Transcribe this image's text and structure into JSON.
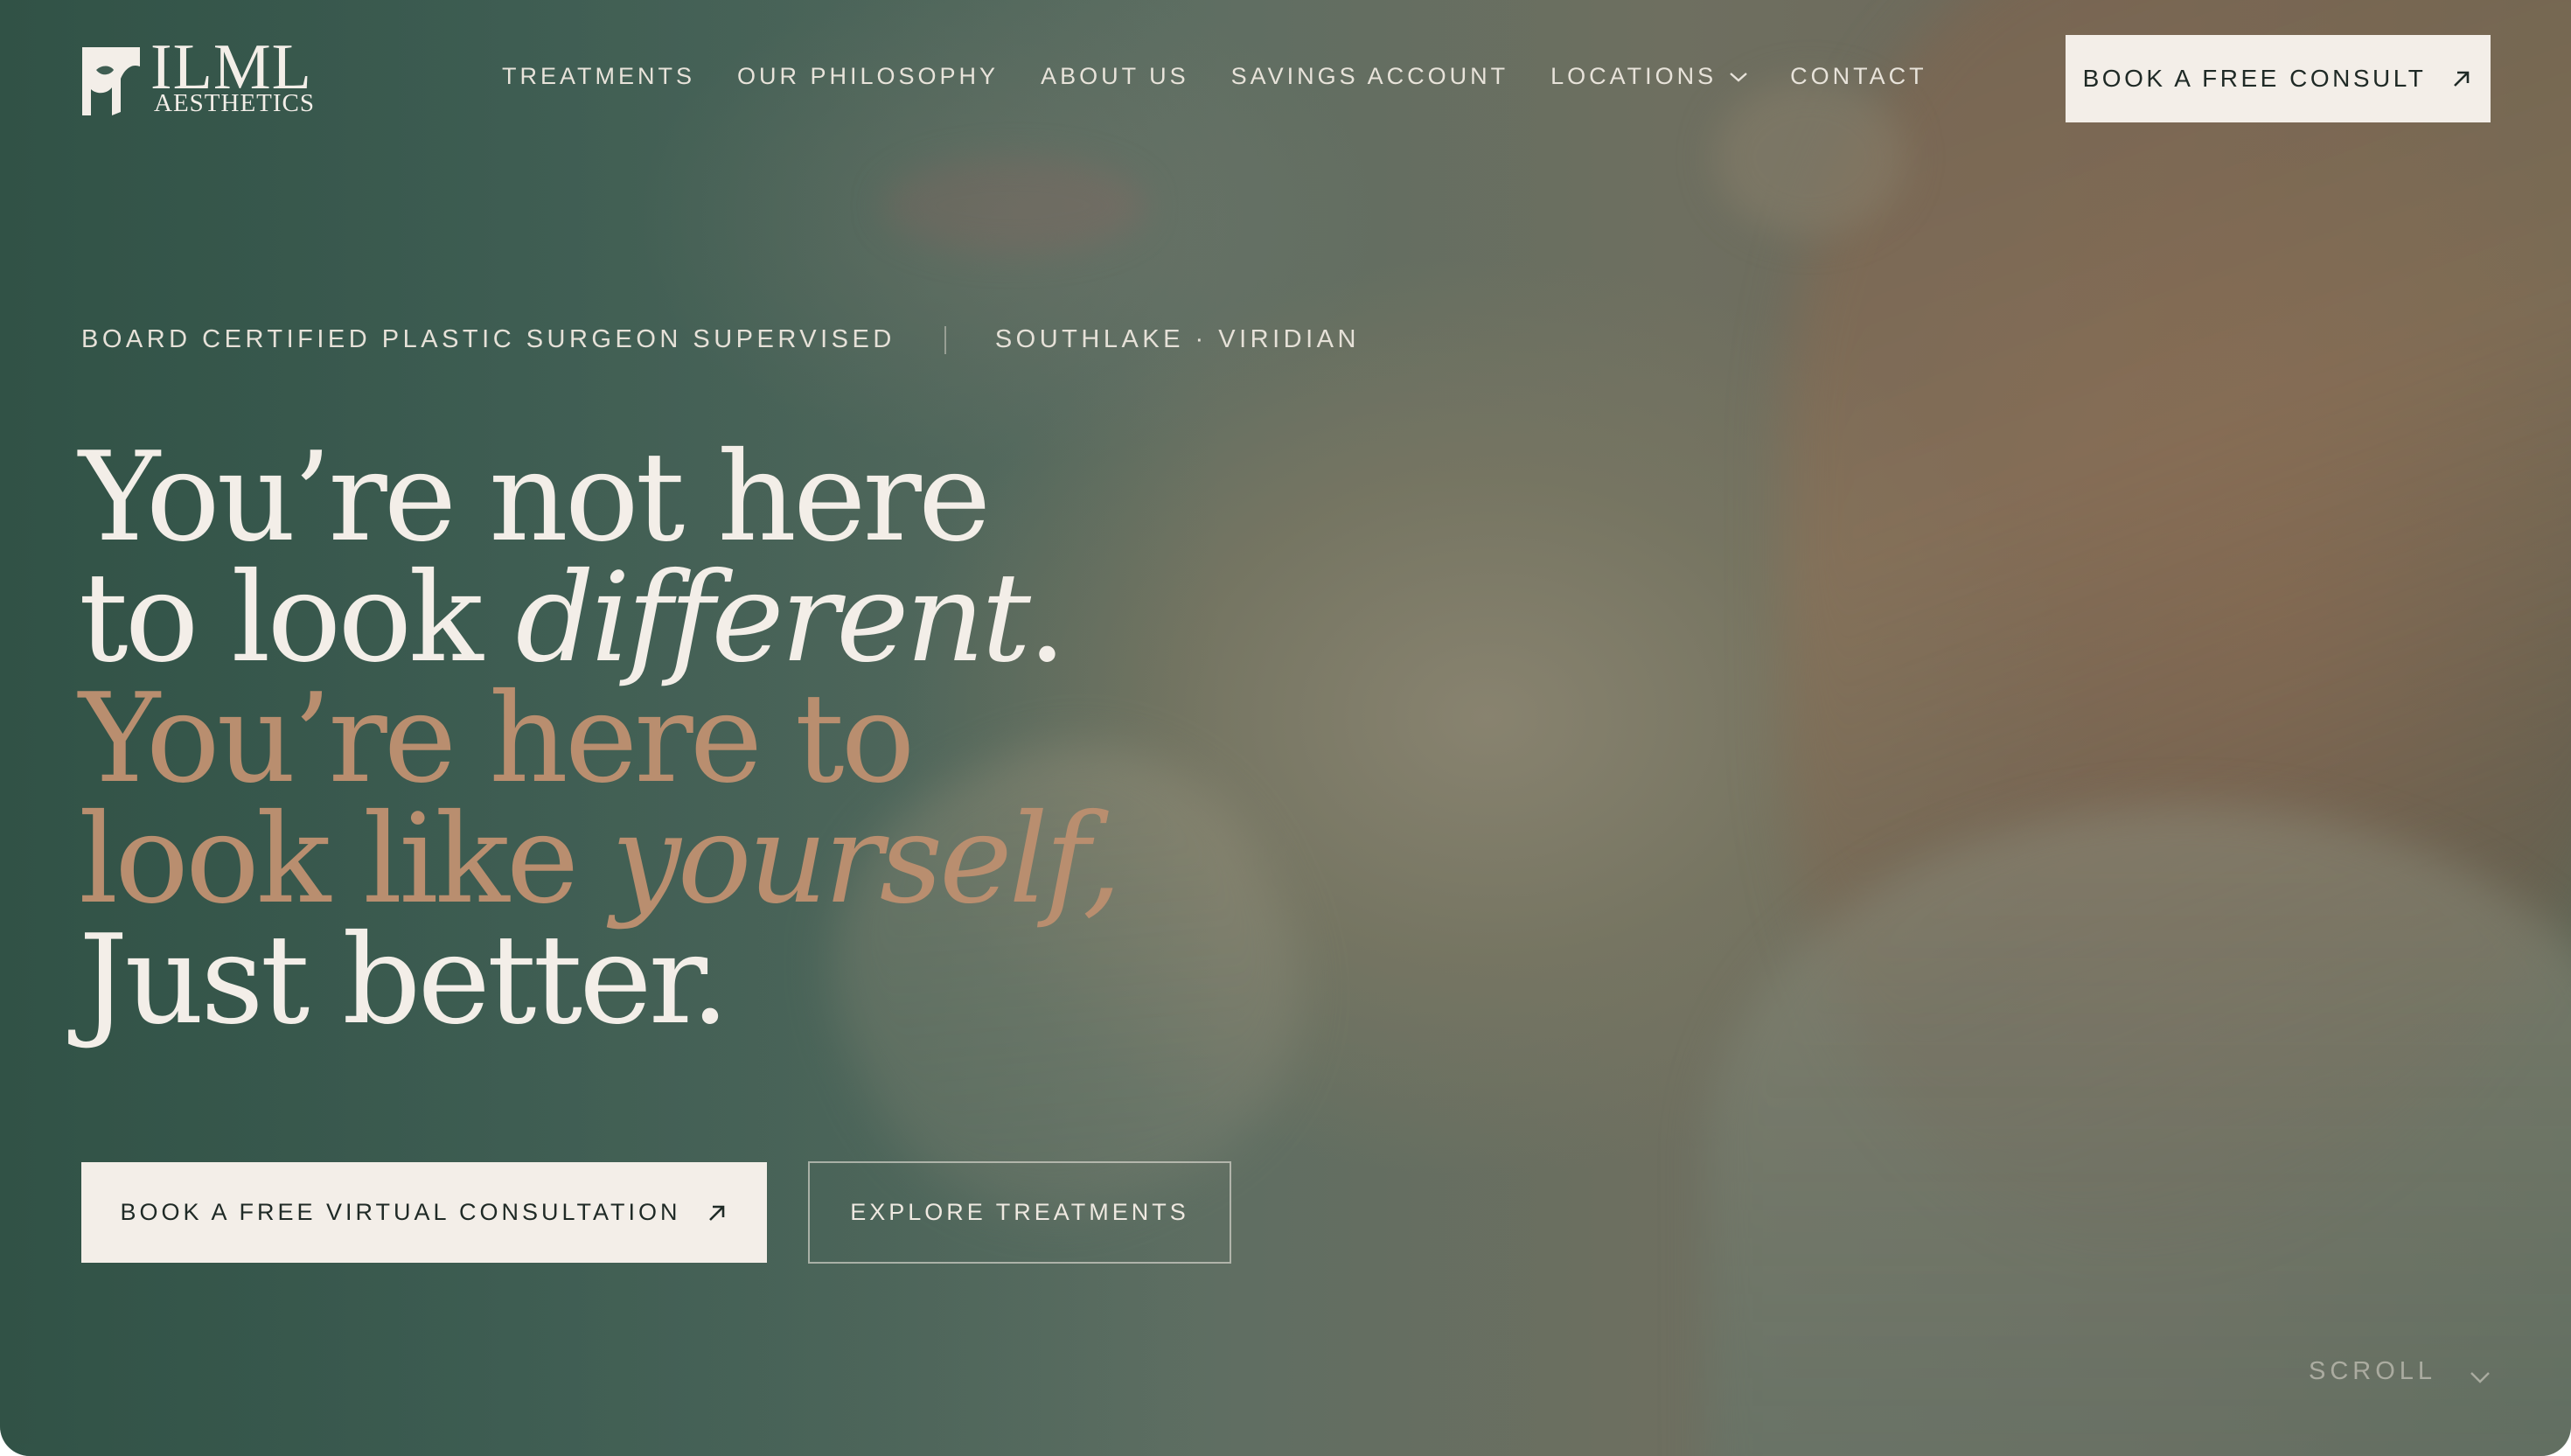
{
  "brand": {
    "wordmark": "ILML",
    "subtitle": "AESTHETICS"
  },
  "nav": {
    "items": [
      {
        "label": "TREATMENTS"
      },
      {
        "label": "OUR PHILOSOPHY"
      },
      {
        "label": "ABOUT US"
      },
      {
        "label": "SAVINGS ACCOUNT"
      },
      {
        "label": "LOCATIONS",
        "has_dropdown": true
      },
      {
        "label": "CONTACT"
      }
    ],
    "cta_label": "BOOK A FREE CONSULT",
    "cta_icon": "arrow-up-right-icon"
  },
  "hero": {
    "eyebrow_left": "BOARD CERTIFIED PLASTIC SURGEON SUPERVISED",
    "eyebrow_right": "SOUTHLAKE · VIRIDIAN",
    "headline": {
      "line1": "You’re not here",
      "line2_a": "to look ",
      "line2_em": "different",
      "line2_b": ".",
      "line3": "You’re here to",
      "line4_a": "look like ",
      "line4_em": "yourself,",
      "line5": "Just better."
    },
    "primary_button": "BOOK A FREE VIRTUAL CONSULTATION",
    "secondary_button": "EXPLORE TREATMENTS",
    "scroll_label": "SCROLL"
  },
  "colors": {
    "cream": "#f3eee8",
    "accent_tan": "#b98e6f",
    "deep_green": "#3a5a4e",
    "text_dark": "#1f2a26"
  }
}
